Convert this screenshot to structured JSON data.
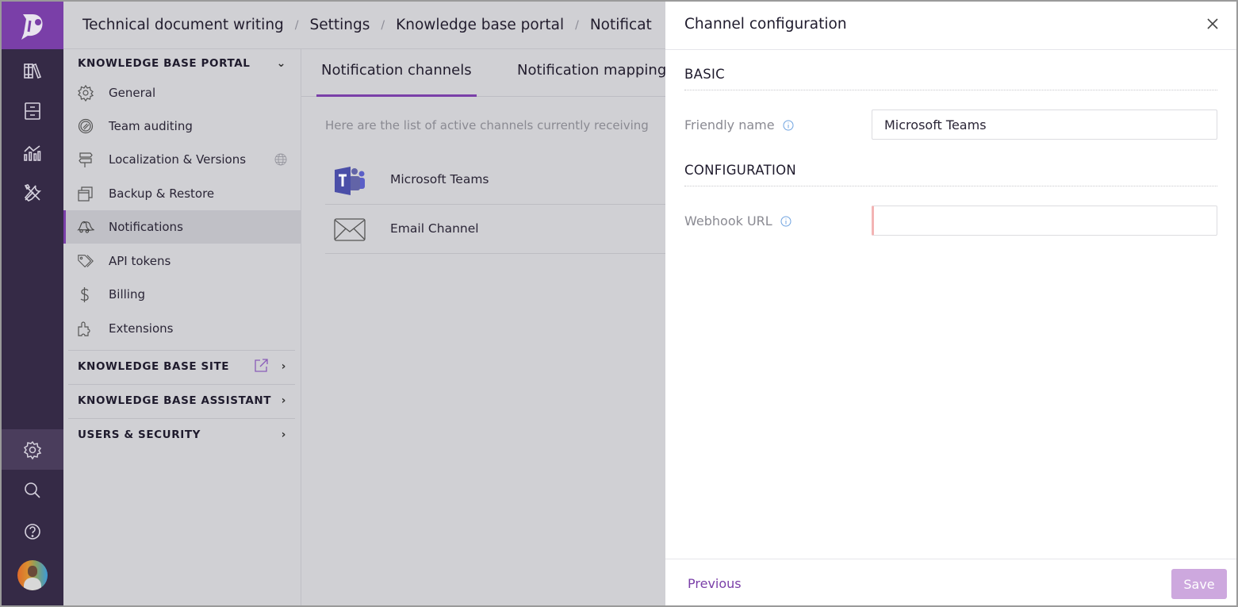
{
  "breadcrumb": [
    "Technical document writing",
    "Settings",
    "Knowledge base portal",
    "Notificat"
  ],
  "rail": {
    "top_icons": [
      "library-icon",
      "cabinet-icon",
      "analytics-icon",
      "tools-icon"
    ],
    "bottom_icons": [
      "settings-icon",
      "search-icon",
      "help-icon"
    ],
    "active": "settings-icon"
  },
  "sidebar": {
    "portal_section": "KNOWLEDGE BASE PORTAL",
    "items": [
      {
        "label": "General",
        "icon": "gear-icon"
      },
      {
        "label": "Team auditing",
        "icon": "audit-icon"
      },
      {
        "label": "Localization & Versions",
        "icon": "signpost-icon"
      },
      {
        "label": "Backup & Restore",
        "icon": "backup-icon"
      },
      {
        "label": "Notifications",
        "icon": "bell-icon"
      },
      {
        "label": "API tokens",
        "icon": "tag-icon"
      },
      {
        "label": "Billing",
        "icon": "dollar-icon"
      },
      {
        "label": "Extensions",
        "icon": "puzzle-icon"
      }
    ],
    "active_item": "Notifications",
    "collapsed_sections": [
      "KNOWLEDGE BASE SITE",
      "KNOWLEDGE BASE ASSISTANT",
      "USERS & SECURITY"
    ]
  },
  "main": {
    "tabs": [
      "Notification channels",
      "Notification mapping"
    ],
    "active_tab": "Notification channels",
    "description": "Here are the list of active channels currently receiving",
    "channels": [
      {
        "label": "Microsoft Teams",
        "icon": "teams-icon"
      },
      {
        "label": "Email Channel",
        "icon": "email-icon"
      }
    ]
  },
  "drawer": {
    "title": "Channel configuration",
    "sections": {
      "basic": "BASIC",
      "configuration": "CONFIGURATION"
    },
    "fields": {
      "friendly_name": {
        "label": "Friendly name",
        "value": "Microsoft Teams"
      },
      "webhook_url": {
        "label": "Webhook URL",
        "value": ""
      }
    },
    "previous_label": "Previous",
    "save_label": "Save"
  },
  "colors": {
    "accent": "#7a3fa8",
    "rail_bg": "#352a46",
    "save_disabled": "#cda8de",
    "error_border": "#f3b4b4"
  }
}
